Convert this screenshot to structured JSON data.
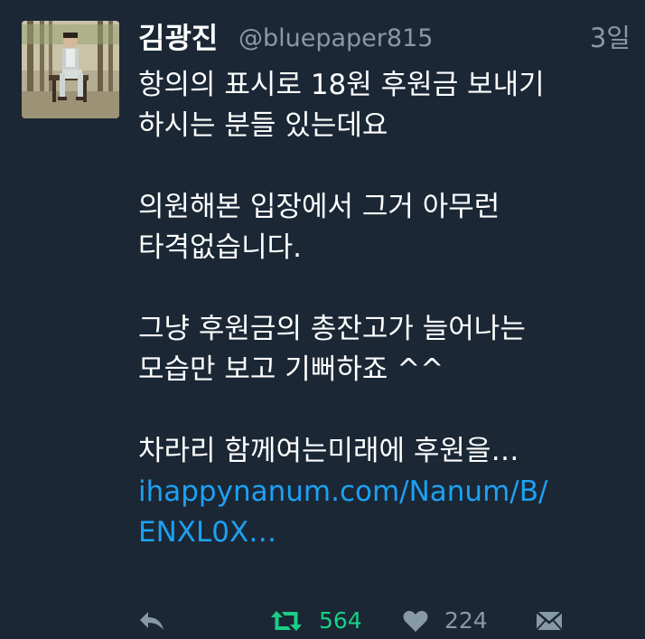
{
  "tweet": {
    "author": {
      "display_name": "김광진",
      "handle": "@bluepaper815"
    },
    "timestamp": "3일",
    "body_lines": [
      "항의의 표시로 18원 후원금 보내기",
      "하시는 분들 있는데요",
      "",
      "의원해본 입장에서 그거 아무런",
      "타격없습니다.",
      "",
      "그냥 후원금의 총잔고가 늘어나는",
      "모습만 보고 기뻐하죠 ^^",
      "",
      "차라리 함께여는미래에 후원을…"
    ],
    "link_lines": [
      "ihappynanum.com/Nanum/B/",
      "ENXL0X…"
    ],
    "actions": {
      "retweet_count": "564",
      "like_count": "224"
    }
  },
  "colors": {
    "background": "#1b2735",
    "text": "#ffffff",
    "secondary": "#8899a6",
    "link": "#1da1f2",
    "retweet": "#19cf86"
  },
  "icons": {
    "reply": "reply-arrow-icon",
    "retweet": "retweet-icon",
    "like": "heart-icon",
    "dm": "envelope-icon"
  }
}
